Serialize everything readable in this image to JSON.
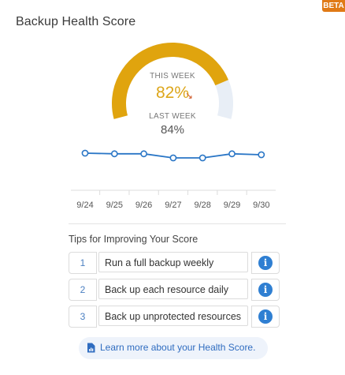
{
  "header": {
    "title": "Backup Health Score",
    "beta_badge": "BETA"
  },
  "gauge": {
    "this_week_label": "THIS WEEK",
    "this_week_value": "82%",
    "this_week_fraction": 0.82,
    "trend_icon": "arrow-down-right-icon",
    "last_week_label": "LAST WEEK",
    "last_week_value": "84%",
    "colors": {
      "fill": "#e0a40e",
      "track": "#e8eef6",
      "value_text": "#dda61a",
      "trend": "#d05a2a"
    }
  },
  "chart_data": {
    "type": "line",
    "categories": [
      "9/24",
      "9/25",
      "9/26",
      "9/27",
      "9/28",
      "9/29",
      "9/30"
    ],
    "values": [
      84,
      83.8,
      83.8,
      82.5,
      82.5,
      83.8,
      83.5
    ],
    "ylim": [
      70,
      95
    ],
    "grid": false,
    "color": "#2a76c6"
  },
  "tips": {
    "title": "Tips for Improving Your Score",
    "items": [
      {
        "number": "1",
        "text": "Run a full backup weekly",
        "icon": "info-icon"
      },
      {
        "number": "2",
        "text": "Back up each resource daily",
        "icon": "info-icon"
      },
      {
        "number": "3",
        "text": "Back up unprotected resources",
        "icon": "info-icon"
      }
    ]
  },
  "learn_more": {
    "label": "Learn more about your Health Score.",
    "icon": "document-icon"
  }
}
